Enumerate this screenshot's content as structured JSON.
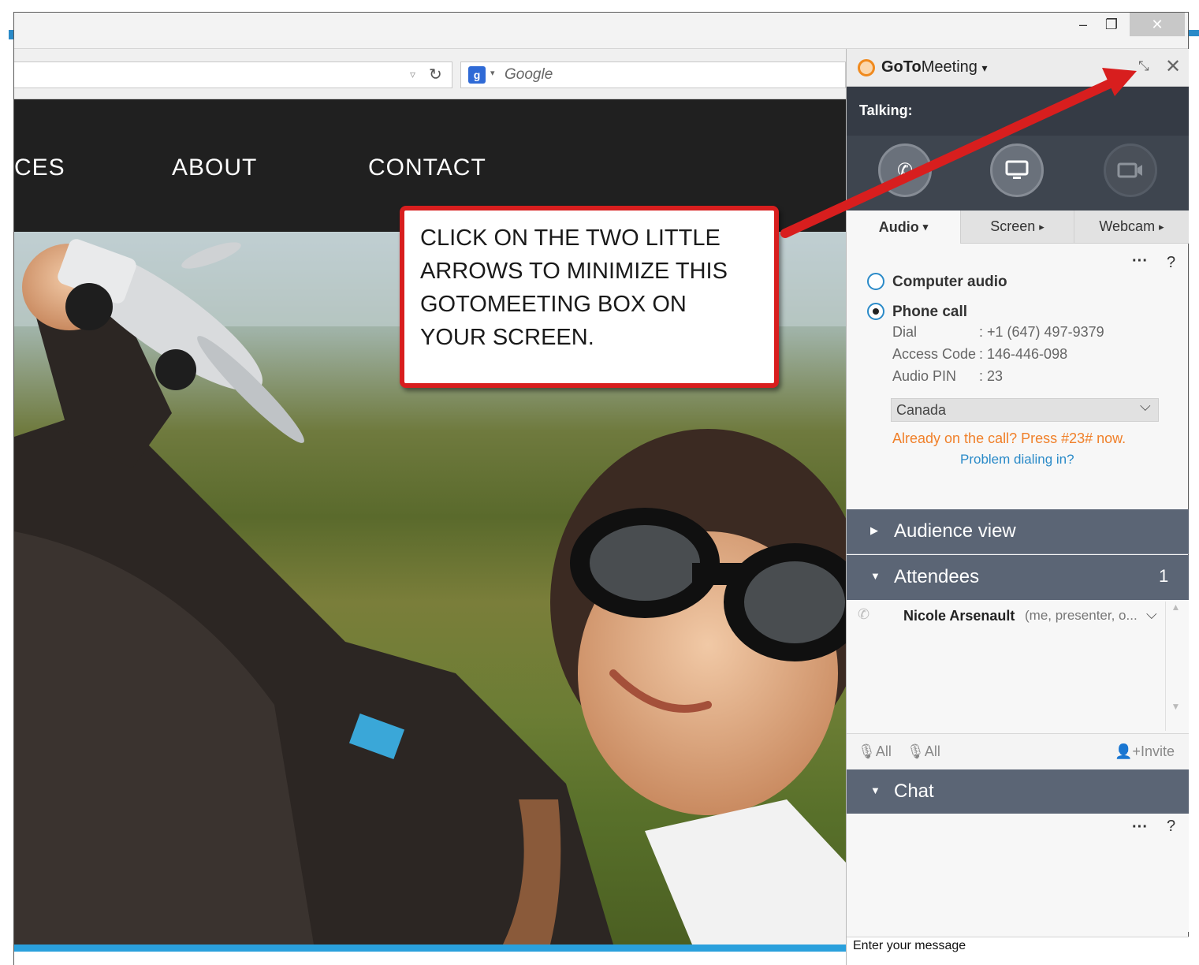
{
  "window": {
    "minimize_icon": "minimize-icon",
    "restore_icon": "restore-icon",
    "close_icon": "close-icon"
  },
  "browser": {
    "search_placeholder": "Google",
    "search_engine_icon": "g-search-engine-icon",
    "reload_icon": "reload-icon"
  },
  "site": {
    "nav": [
      "CES",
      "ABOUT",
      "CONTACT"
    ]
  },
  "callout": {
    "text": "CLICK ON THE TWO LITTLE ARROWS TO MINIMIZE THIS GOTOMEETING BOX ON YOUR SCREEN.",
    "border_color": "#d81e1e"
  },
  "gtm": {
    "title_prefix": "GoTo",
    "title_suffix": "Meeting",
    "talking_label": "Talking:",
    "tabs": [
      {
        "label": "Audio",
        "caret": "▾"
      },
      {
        "label": "Screen",
        "caret": "▸"
      },
      {
        "label": "Webcam",
        "caret": "▸"
      }
    ],
    "more": "···",
    "help": "?",
    "audio_options": {
      "computer": "Computer audio",
      "phone": "Phone call"
    },
    "dial": {
      "dial_label": "Dial",
      "dial_value": ": +1 (647) 497-9379",
      "code_label": "Access Code",
      "code_value": ": 146-446-098",
      "pin_label": "Audio PIN",
      "pin_value": ": 23"
    },
    "country": "Canada",
    "already_text": "Already on the call? Press #23# now.",
    "problem_text": "Problem dialing in?",
    "sections": {
      "audience": "Audience view",
      "attendees": "Attendees",
      "attendee_count": "1",
      "chat": "Chat"
    },
    "attendee": {
      "name": "Nicole Arsenault",
      "role": "(me, presenter, o..."
    },
    "actions": {
      "mute_all": "All",
      "unmute_all": "All",
      "invite": "Invite"
    },
    "chat_placeholder": "Enter your message",
    "accent_orange": "#f0802a",
    "accent_blue": "#2a8ac8",
    "header_dark": "#353b45",
    "section_blue": "#5b6575"
  }
}
